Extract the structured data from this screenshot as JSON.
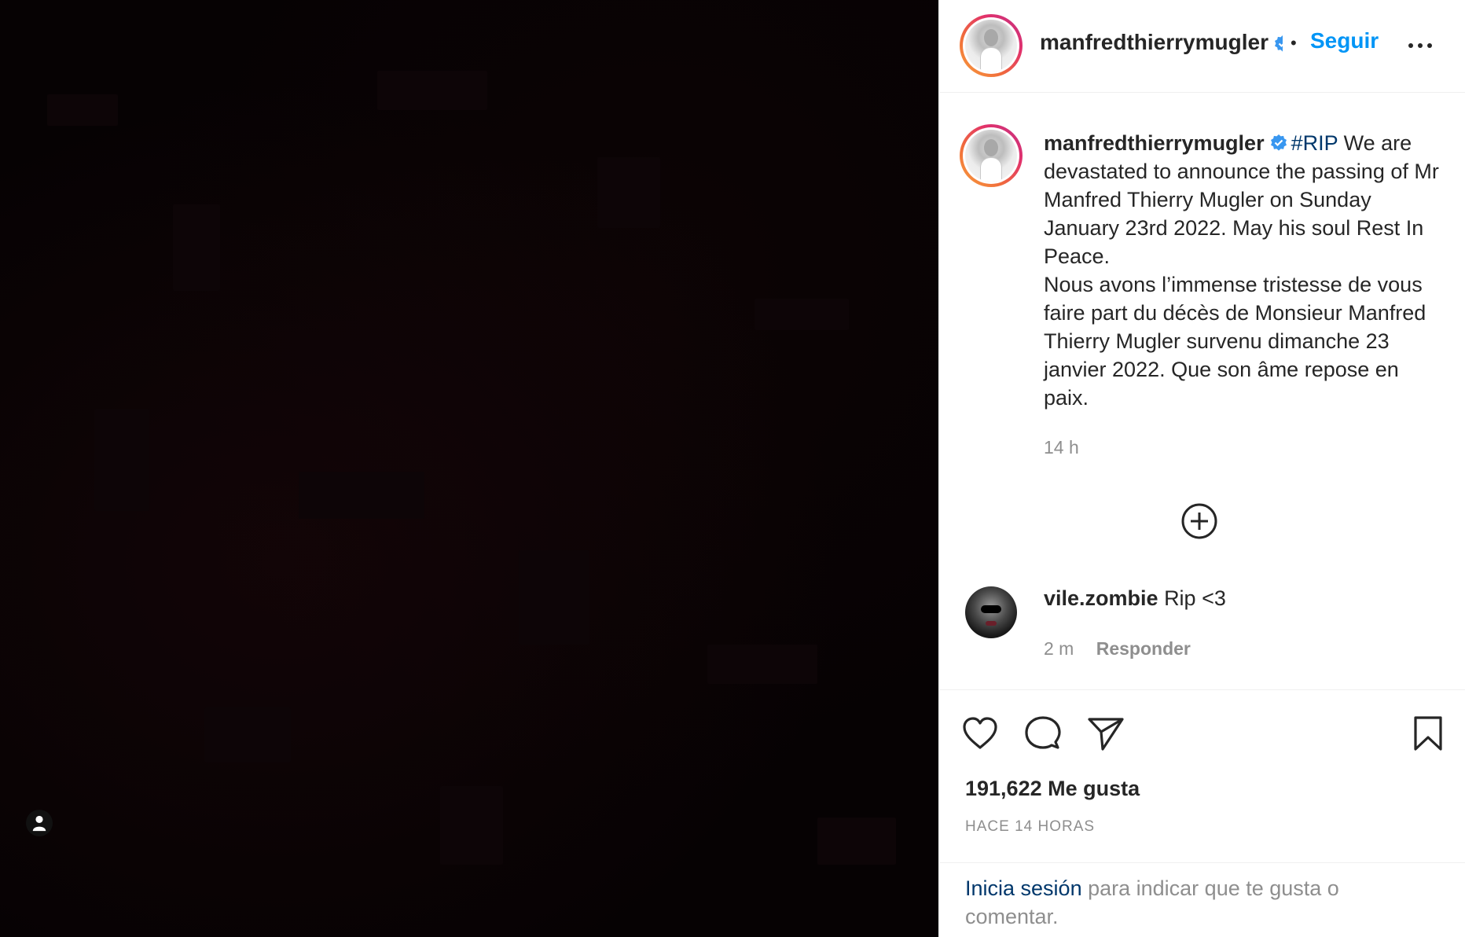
{
  "post": {
    "author": "manfredthierrymugler",
    "follow_label": "Seguir",
    "dot": "•"
  },
  "caption": {
    "author": "manfredthierrymugler",
    "hashtag": "#RIP",
    "body_en": "We are devastated to announce the passing of Mr Manfred Thierry Mugler on Sunday January 23rd 2022. May his soul Rest In Peace.",
    "body_fr": "Nous avons l’immense tristesse de vous faire part du décès de Monsieur Manfred Thierry Mugler survenu dimanche 23 janvier 2022. Que son âme repose en paix.",
    "time": "14 h"
  },
  "comments": [
    {
      "user": "vile.zombie",
      "text": "Rip <3",
      "time": "2 m",
      "reply_label": "Responder"
    }
  ],
  "actions": {
    "likes": "191,622 Me gusta",
    "ago": "HACE 14 HORAS"
  },
  "login": {
    "link": "Inicia sesión",
    "rest": " para indicar que te gusta o comentar."
  },
  "colors": {
    "accent": "#0095f6",
    "link": "#00376b",
    "verified": "#3897f0",
    "text": "#262626",
    "muted": "#8e8e8e"
  },
  "icons": {
    "verified": "verified-badge-icon",
    "more": "more-options-icon",
    "plus": "load-more-comments-icon",
    "like": "heart-icon",
    "comment": "comment-bubble-icon",
    "share": "paper-plane-icon",
    "save": "bookmark-icon",
    "user_tag": "person-icon"
  }
}
